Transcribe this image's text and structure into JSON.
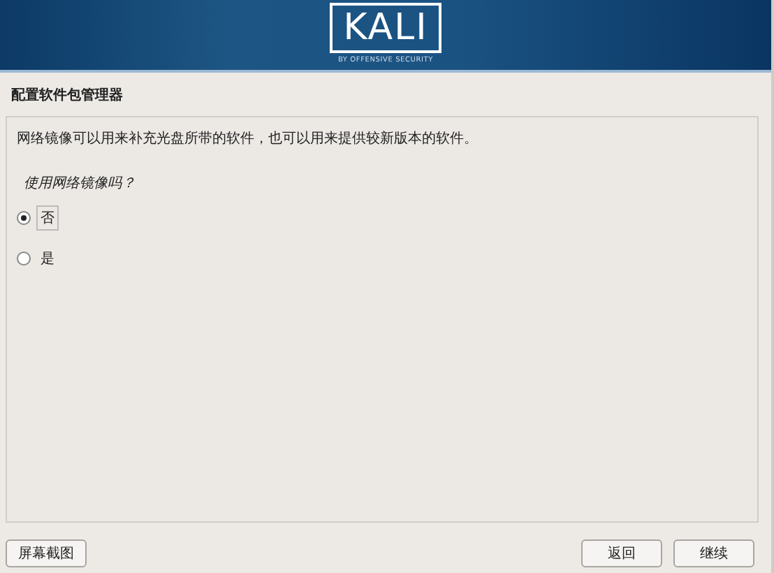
{
  "header": {
    "logo": "KALI",
    "tagline": "BY OFFENSIVE SECURITY"
  },
  "title": "配置软件包管理器",
  "description": "网络镜像可以用来补充光盘所带的软件，也可以用来提供较新版本的软件。",
  "question": "使用网络镜像吗？",
  "options": [
    {
      "label": "否",
      "selected": true
    },
    {
      "label": "是",
      "selected": false
    }
  ],
  "buttons": {
    "left": [
      "屏幕截图"
    ],
    "right": [
      "返回",
      "继续"
    ]
  }
}
